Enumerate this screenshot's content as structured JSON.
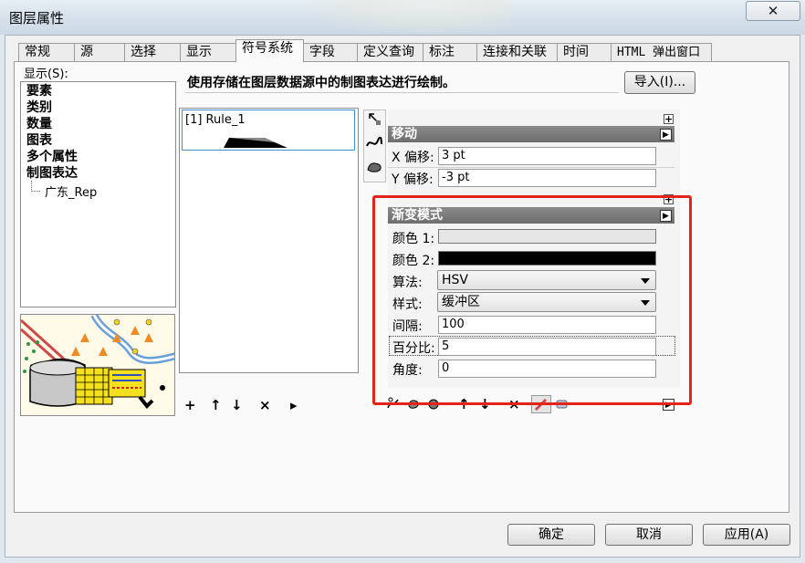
{
  "window": {
    "title": "图层属性",
    "close_symbol": "✕"
  },
  "tabs": [
    {
      "label": "常规"
    },
    {
      "label": "源"
    },
    {
      "label": "选择"
    },
    {
      "label": "显示"
    },
    {
      "label": "符号系统",
      "active": true
    },
    {
      "label": "字段"
    },
    {
      "label": "定义查询"
    },
    {
      "label": "标注"
    },
    {
      "label": "连接和关联"
    },
    {
      "label": "时间"
    },
    {
      "label": "HTML 弹出窗口"
    }
  ],
  "show_panel": {
    "label": "显示(S):",
    "items": [
      "要素",
      "类别",
      "数量",
      "图表",
      "多个属性",
      "制图表达"
    ],
    "sub_item": "广东_Rep"
  },
  "description": "使用存储在图层数据源中的制图表达进行绘制。",
  "import_button": "导入(I)...",
  "rules": [
    {
      "label": "[1] Rule_1"
    }
  ],
  "rule_controls": {
    "add": "+",
    "up": "↑",
    "down": "↓",
    "remove": "×",
    "more": "▸"
  },
  "move_panel": {
    "title": "移动",
    "x_label": "X 偏移:",
    "x_value": "3 pt",
    "y_label": "Y 偏移:",
    "y_value": "-3 pt"
  },
  "gradient_panel": {
    "title": "渐变模式",
    "color1_label": "颜色 1:",
    "color1": "#e6e6e6",
    "color2_label": "颜色 2:",
    "color2": "#000000",
    "algorithm_label": "算法:",
    "algorithm_value": "HSV",
    "style_label": "样式:",
    "style_value": "缓冲区",
    "interval_label": "间隔:",
    "interval_value": "100",
    "percent_label": "百分比:",
    "percent_value": "5",
    "angle_label": "角度:",
    "angle_value": "0"
  },
  "buttons": {
    "ok": "确定",
    "cancel": "取消",
    "apply": "应用(A)"
  },
  "colors": {
    "highlight": "#e1251b",
    "header": "#7a7a7a",
    "selection": "#3b8fd6"
  }
}
